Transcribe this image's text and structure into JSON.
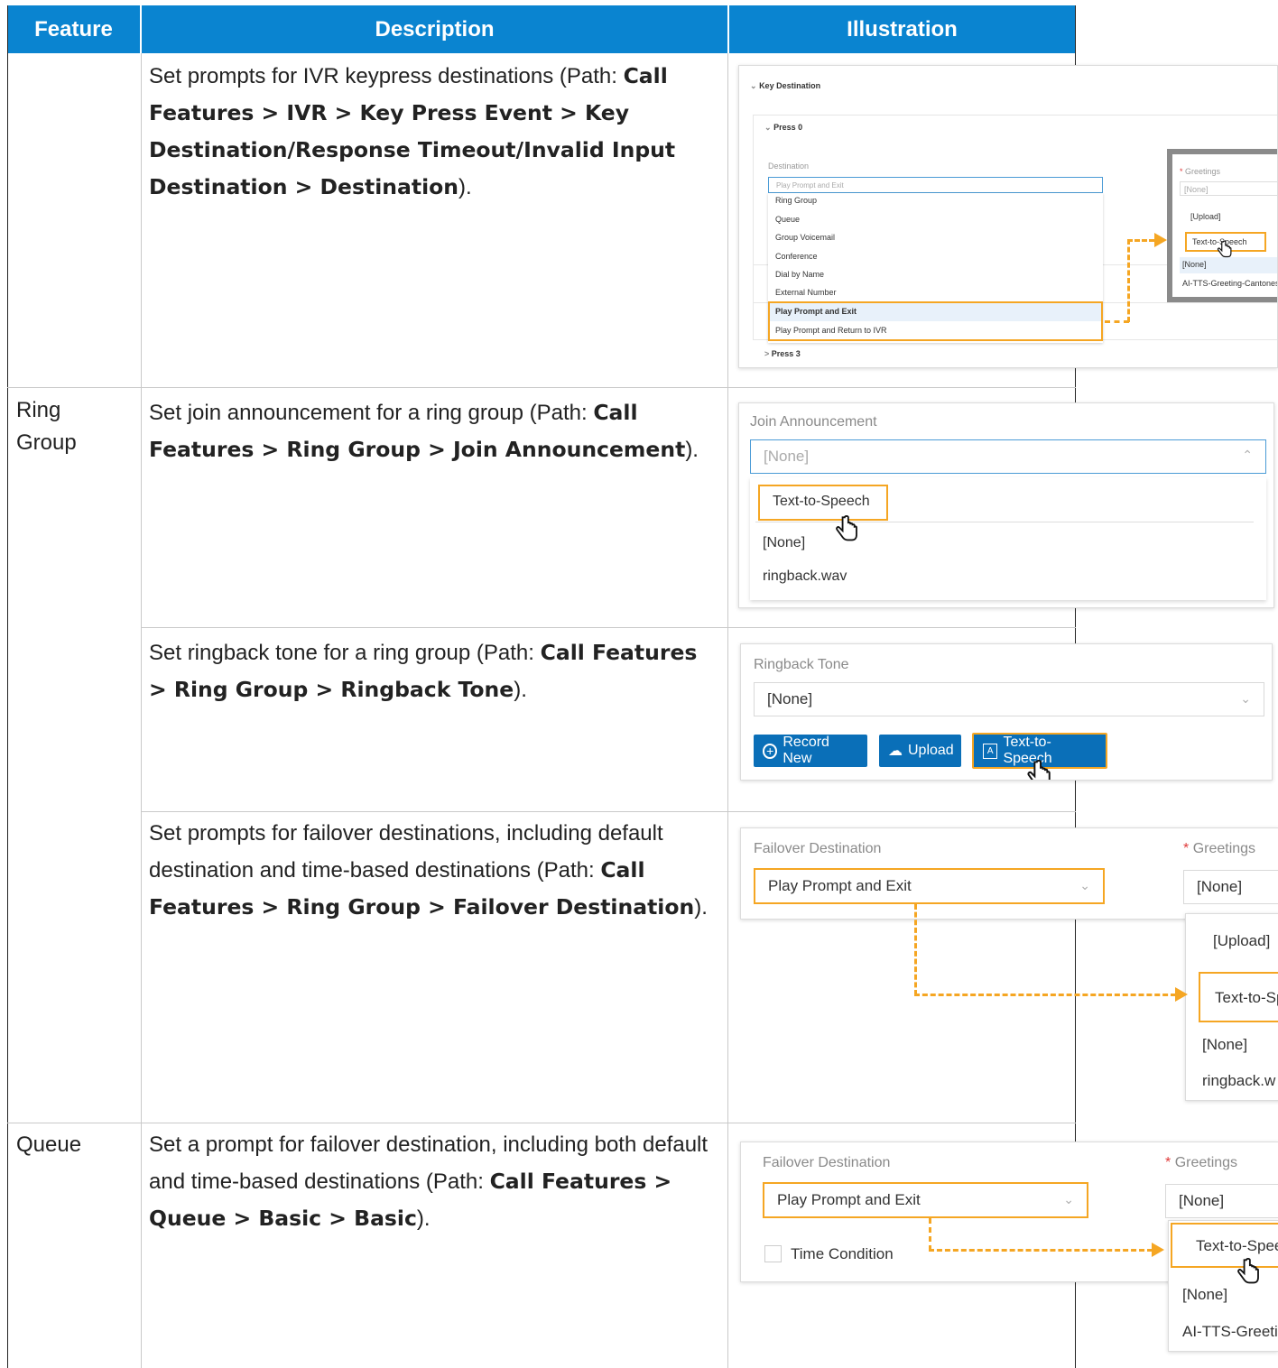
{
  "header": {
    "feature": "Feature",
    "description": "Description",
    "illustration": "Illustration"
  },
  "rows": [
    {
      "feature": "",
      "desc_prefix": "Set prompts for IVR keypress destinations (Path: ",
      "desc_path": "Call Features > IVR > Key Press Event > Key Destination/Response Timeout/Invalid Input Destination > Destination",
      "desc_suffix": ")."
    },
    {
      "feature": "Ring Group",
      "desc_prefix": "Set join announcement for a ring group (Path: ",
      "desc_path": "Call Features > Ring Group > Join Announcement",
      "desc_suffix": ")."
    },
    {
      "feature": "",
      "desc_prefix": "Set ringback tone for a ring group (Path: ",
      "desc_path": "Call Features > Ring Group > Ringback Tone",
      "desc_suffix": ")."
    },
    {
      "feature": "",
      "desc_prefix": "Set prompts for failover destinations, including default destination and time-based destinations (Path: ",
      "desc_path": "Call Features > Ring Group > Failover Destination",
      "desc_suffix": ")."
    },
    {
      "feature": "Queue",
      "desc_prefix": "Set a prompt for failover destination, including both default and time-based destinations (Path: ",
      "desc_path": "Call Features > Queue > Basic > Basic",
      "desc_suffix": ")."
    }
  ],
  "ivr": {
    "section": "Key Destination",
    "press0": "Press 0",
    "press3": "Press 3",
    "destination_label": "Destination",
    "destination_value": "Play Prompt and Exit",
    "options": [
      "Ring Group",
      "Queue",
      "Group Voicemail",
      "Conference",
      "Dial by Name",
      "External Number",
      "Play Prompt and Exit",
      "Play Prompt and Return to IVR"
    ],
    "greetings_label": "Greetings",
    "greetings_value": "[None]",
    "greet_options": [
      "[Upload]",
      "Text-to-Speech",
      "[None]",
      "AI-TTS-Greeting-Cantonese"
    ]
  },
  "join": {
    "label": "Join Announcement",
    "value": "[None]",
    "options": [
      "Text-to-Speech",
      "[None]",
      "ringback.wav"
    ]
  },
  "ringback": {
    "label": "Ringback Tone",
    "value": "[None]",
    "buttons": [
      "Record New",
      "Upload",
      "Text-to-Speech"
    ]
  },
  "rg_failover": {
    "label": "Failover Destination",
    "value": "Play Prompt and Exit",
    "greetings_label": "Greetings",
    "greetings_value": "[None]",
    "options": [
      "[Upload]",
      "Text-to-Sp",
      "[None]",
      "ringback.w"
    ]
  },
  "q_failover": {
    "label": "Failover Destination",
    "value": "Play Prompt and Exit",
    "time_condition": "Time Condition",
    "greetings_label": "Greetings",
    "greetings_value": "[None]",
    "options": [
      "Text-to-Spee",
      "[None]",
      "AI-TTS-Greeti"
    ]
  }
}
